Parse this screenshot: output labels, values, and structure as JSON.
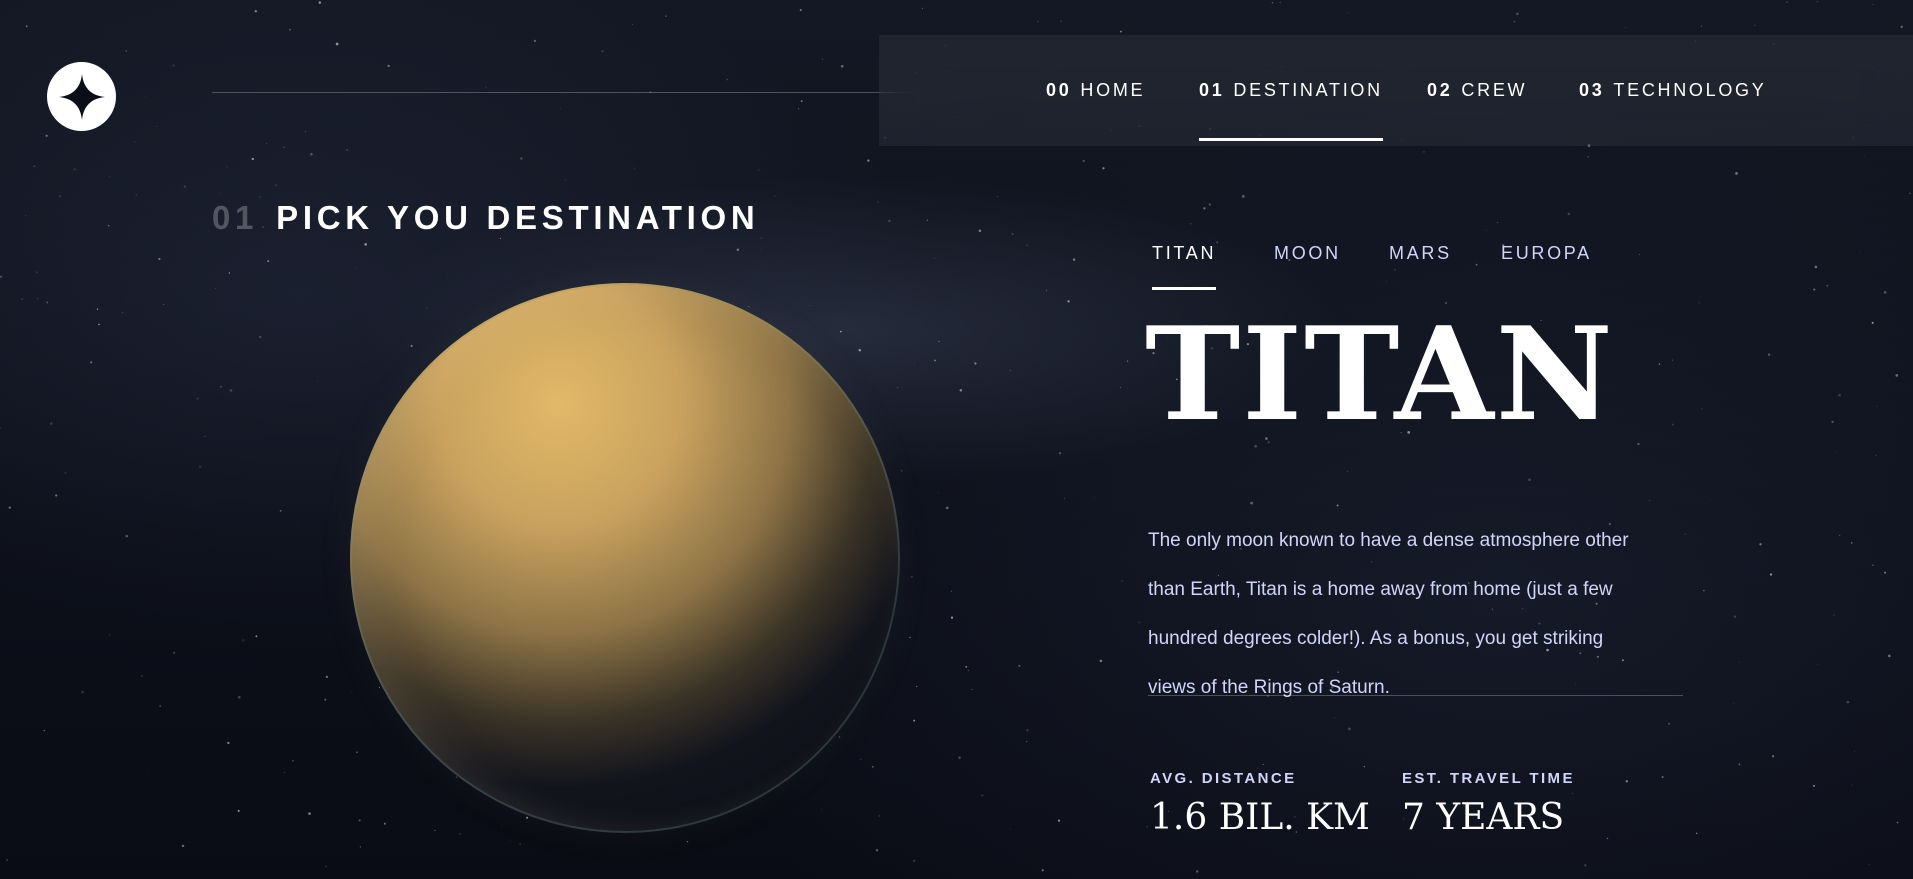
{
  "header": {
    "logo_icon": "four-point-star-icon",
    "nav": [
      {
        "num": "00",
        "label": "HOME"
      },
      {
        "num": "01",
        "label": "DESTINATION"
      },
      {
        "num": "02",
        "label": "CREW"
      },
      {
        "num": "03",
        "label": "TECHNOLOGY"
      }
    ],
    "active_nav": "DESTINATION"
  },
  "heading": {
    "num": "01",
    "text": "PICK YOU DESTINATION"
  },
  "tabs": [
    {
      "label": "TITAN"
    },
    {
      "label": "MOON"
    },
    {
      "label": "MARS"
    },
    {
      "label": "EUROPA"
    }
  ],
  "active_tab": "TITAN",
  "destination": {
    "name": "TITAN",
    "description": "The only moon known to have a dense atmosphere other than Earth, Titan is a home away from home (just a few hundred degrees colder!). As a bonus, you get striking views of the Rings of Saturn.",
    "stats": [
      {
        "label": "AVG. DISTANCE",
        "value": "1.6 BIL. KM"
      },
      {
        "label": "EST. TRAVEL TIME",
        "value": "7 YEARS"
      }
    ]
  },
  "colors": {
    "background": "#0b0d17",
    "accent_text": "#d0d6f9",
    "white": "#ffffff"
  }
}
